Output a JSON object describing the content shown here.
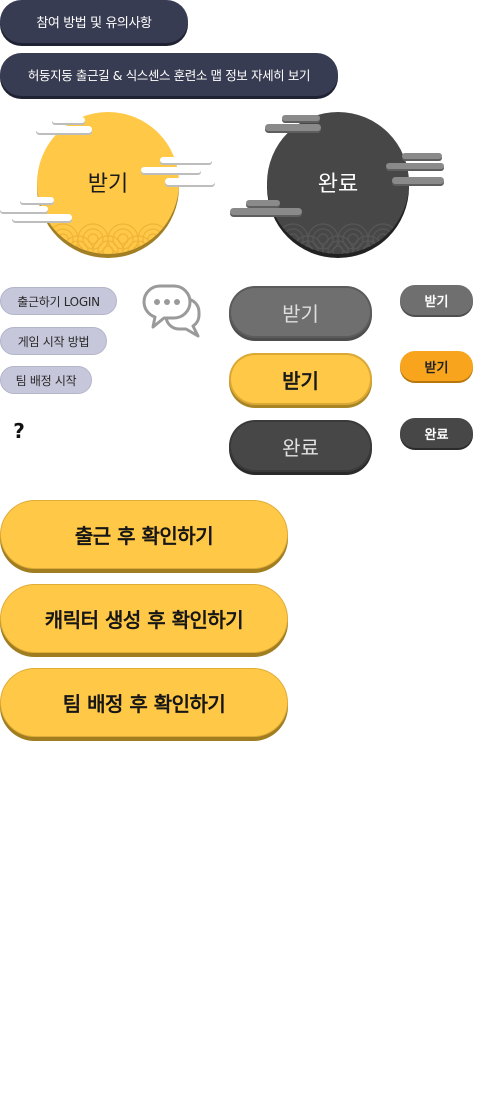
{
  "info_buttons": {
    "guide_label": "참여 방법 및 유의사항",
    "map_info_label": "허둥지둥 출근길 & 식스센스 훈련소 맵 정보 자세히 보기"
  },
  "reward_circles": {
    "receive_label": "받기",
    "done_label": "완료"
  },
  "menu_pills": {
    "login_label": "출근하기 LOGIN",
    "how_to_play_label": "게임 시작 방법",
    "team_assign_label": "팀 배정 시작"
  },
  "help_mark": "?",
  "icons": {
    "chat": "chat-bubbles-icon",
    "cloud": "cloud-icon",
    "pattern": "wave-pattern"
  },
  "medium_buttons": [
    {
      "label": "받기"
    },
    {
      "label": "받기"
    },
    {
      "label": "완료"
    }
  ],
  "small_buttons": [
    {
      "label": "받기"
    },
    {
      "label": "받기"
    },
    {
      "label": "완료"
    }
  ],
  "confirm_buttons": [
    {
      "label": "출근 후 확인하기"
    },
    {
      "label": "캐릭터 생성 후 확인하기"
    },
    {
      "label": "팀 배정 후 확인하기"
    }
  ],
  "colors": {
    "navy": "#383c52",
    "yellow": "#ffc846",
    "orange": "#f8a51d",
    "grey": "#6f6f6f",
    "dark": "#474747",
    "lavender": "#c6c7da",
    "cloud_light": "#ffffff",
    "cloud_grey": "#8a8a8a"
  }
}
